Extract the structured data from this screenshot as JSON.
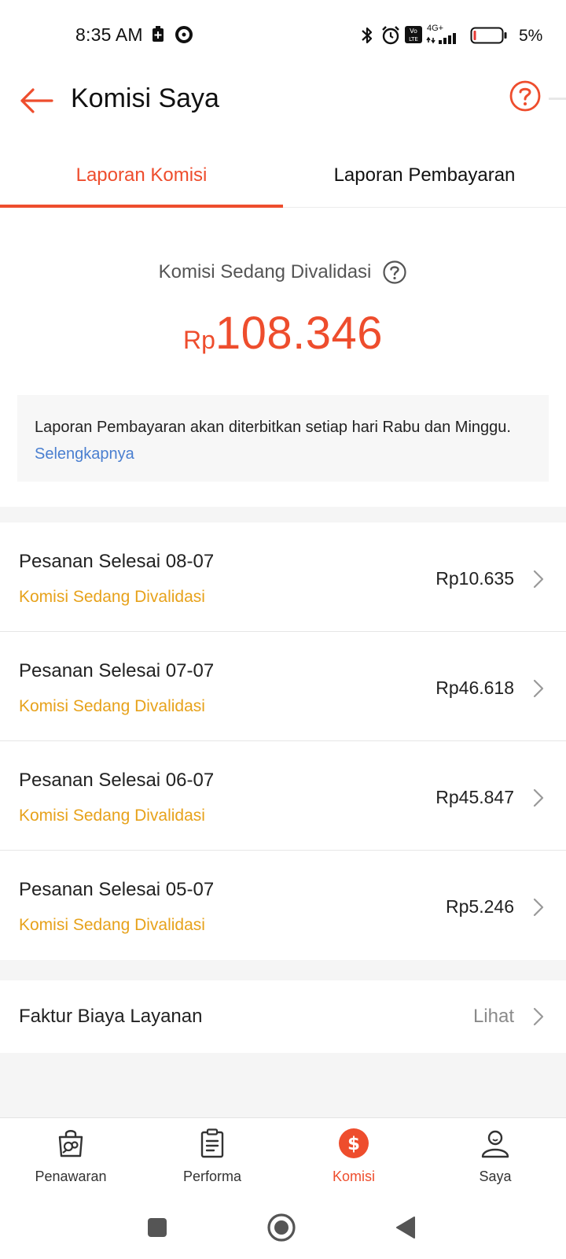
{
  "status_bar": {
    "time": "8:35 AM",
    "network": "4G+",
    "battery": "5%",
    "icons": [
      "battery-saver-icon",
      "location-icon",
      "bluetooth-icon",
      "alarm-icon",
      "volte-icon",
      "signal-icon",
      "battery-icon"
    ]
  },
  "header": {
    "title": "Komisi Saya",
    "back_icon": "arrow-left-icon",
    "help_icon": "question-circle-icon"
  },
  "tabs": [
    {
      "label": "Laporan Komisi",
      "active": true
    },
    {
      "label": "Laporan Pembayaran",
      "active": false
    }
  ],
  "summary": {
    "label": "Komisi Sedang Divalidasi",
    "currency": "Rp",
    "amount": "108.346",
    "notice_text": "Laporan Pembayaran akan diterbitkan setiap hari Rabu dan Minggu.",
    "notice_link": "Selengkapnya"
  },
  "orders": [
    {
      "title": "Pesanan Selesai 08-07",
      "status": "Komisi Sedang Divalidasi",
      "amount": "Rp10.635"
    },
    {
      "title": "Pesanan Selesai 07-07",
      "status": "Komisi Sedang Divalidasi",
      "amount": "Rp46.618"
    },
    {
      "title": "Pesanan Selesai 06-07",
      "status": "Komisi Sedang Divalidasi",
      "amount": "Rp45.847"
    },
    {
      "title": "Pesanan Selesai 05-07",
      "status": "Komisi Sedang Divalidasi",
      "amount": "Rp5.246"
    }
  ],
  "service_fee": {
    "label": "Faktur Biaya Layanan",
    "action": "Lihat"
  },
  "bottom_nav": [
    {
      "label": "Penawaran",
      "icon": "shopping-bag-icon",
      "active": false
    },
    {
      "label": "Performa",
      "icon": "clipboard-icon",
      "active": false
    },
    {
      "label": "Komisi",
      "icon": "dollar-circle-icon",
      "active": true
    },
    {
      "label": "Saya",
      "icon": "user-icon",
      "active": false
    }
  ],
  "colors": {
    "accent": "#ee4d2d",
    "status_pending": "#e7a21b",
    "link": "#4a7fd0"
  }
}
